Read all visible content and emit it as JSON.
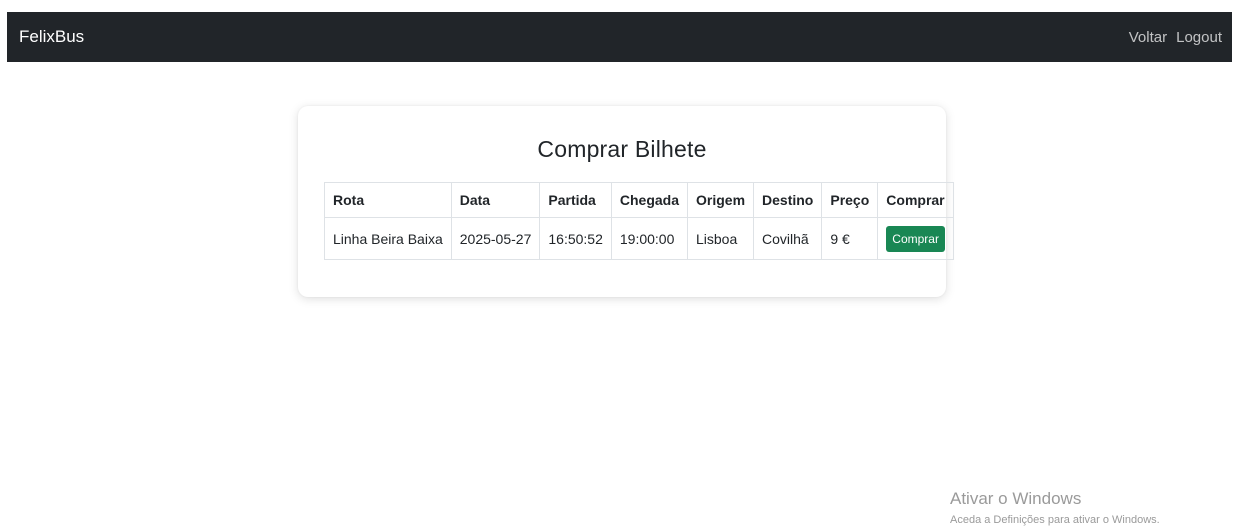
{
  "navbar": {
    "brand": "FelixBus",
    "links": [
      "Voltar",
      "Logout"
    ]
  },
  "page": {
    "title": "Comprar Bilhete"
  },
  "table": {
    "headers": [
      "Rota",
      "Data",
      "Partida",
      "Chegada",
      "Origem",
      "Destino",
      "Preço",
      "Comprar"
    ],
    "rows": [
      {
        "rota": "Linha Beira Baixa",
        "data": "2025-05-27",
        "partida": "16:50:52",
        "chegada": "19:00:00",
        "origem": "Lisboa",
        "destino": "Covilhã",
        "preco": "9 €",
        "comprar_label": "Comprar"
      }
    ]
  },
  "watermark": {
    "title": "Ativar o Windows",
    "subtitle": "Aceda a Definições para ativar o Windows."
  },
  "colors": {
    "navbar_bg": "#212529",
    "button_bg": "#198754"
  }
}
